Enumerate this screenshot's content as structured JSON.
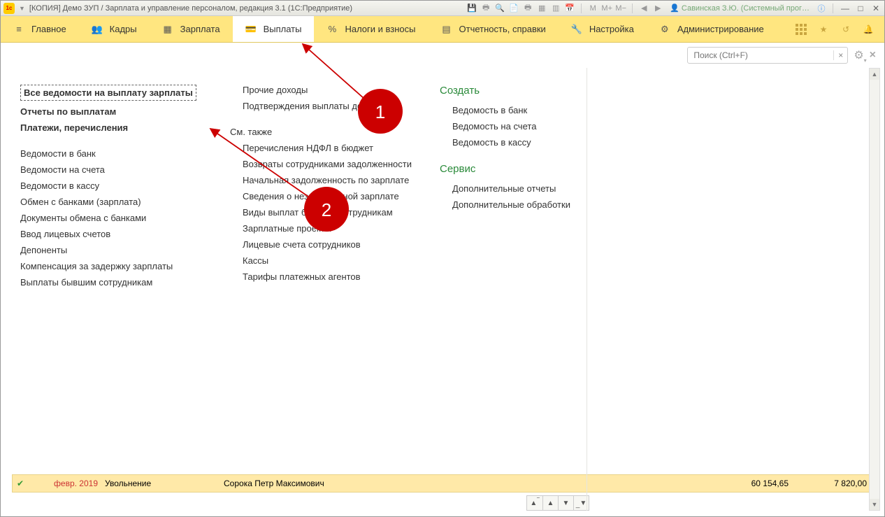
{
  "title": "[КОПИЯ] Демо ЗУП / Зарплата и управление персоналом, редакция 3.1  (1С:Предприятие)",
  "user": "Савинская З.Ю. (Системный прог…",
  "nav": {
    "main": "Главное",
    "kadry": "Кадры",
    "zarplata": "Зарплата",
    "vyplaty": "Выплаты",
    "nalogi": "Налоги и взносы",
    "otchet": "Отчетность, справки",
    "nastroika": "Настройка",
    "admin": "Администрирование"
  },
  "search_placeholder": "Поиск (Ctrl+F)",
  "col1": {
    "all_vedomosti": "Все ведомости на выплату зарплаты",
    "reports": "Отчеты по выплатам",
    "payments": "Платежи, перечисления",
    "items": [
      "Ведомости в банк",
      "Ведомости на счета",
      "Ведомости в кассу",
      "Обмен с банками (зарплата)",
      "Документы обмена с банками",
      "Ввод лицевых счетов",
      "Депоненты",
      "Компенсация за задержку зарплаты",
      "Выплаты бывшим сотрудникам"
    ]
  },
  "col2": {
    "top": [
      "Прочие доходы",
      "Подтверждения выплаты доходов"
    ],
    "see_also": "См. также",
    "items": [
      "Перечисления НДФЛ в бюджет",
      "Возвраты сотрудниками задолженности",
      "Начальная задолженность по зарплате",
      "Сведения о незачисленной зарплате",
      "Виды выплат бывшим сотрудникам",
      "Зарплатные проекты",
      "Лицевые счета сотрудников",
      "Кассы",
      "Тарифы платежных агентов"
    ]
  },
  "col3": {
    "create": "Создать",
    "create_items": [
      "Ведомость в банк",
      "Ведомость на счета",
      "Ведомость в кассу"
    ],
    "service": "Сервис",
    "service_items": [
      "Дополнительные отчеты",
      "Дополнительные обработки"
    ]
  },
  "bottom": {
    "date": "февр. 2019",
    "type": "Увольнение",
    "name": "Сорока Петр Максимович",
    "n1": "60 154,65",
    "n2": "7 820,00"
  },
  "anno": {
    "one": "1",
    "two": "2"
  }
}
